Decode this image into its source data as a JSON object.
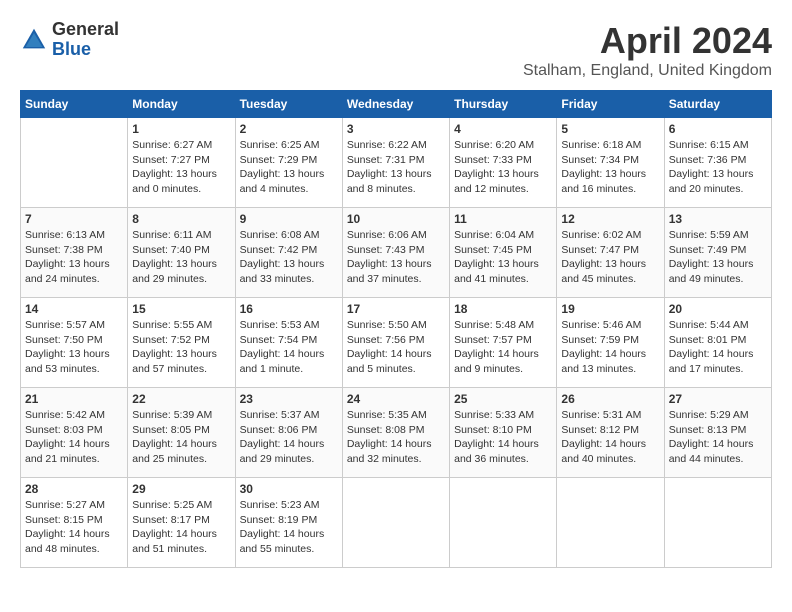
{
  "logo": {
    "general": "General",
    "blue": "Blue"
  },
  "title": "April 2024",
  "location": "Stalham, England, United Kingdom",
  "days_of_week": [
    "Sunday",
    "Monday",
    "Tuesday",
    "Wednesday",
    "Thursday",
    "Friday",
    "Saturday"
  ],
  "weeks": [
    [
      {
        "day": "",
        "content": ""
      },
      {
        "day": "1",
        "content": "Sunrise: 6:27 AM\nSunset: 7:27 PM\nDaylight: 13 hours\nand 0 minutes."
      },
      {
        "day": "2",
        "content": "Sunrise: 6:25 AM\nSunset: 7:29 PM\nDaylight: 13 hours\nand 4 minutes."
      },
      {
        "day": "3",
        "content": "Sunrise: 6:22 AM\nSunset: 7:31 PM\nDaylight: 13 hours\nand 8 minutes."
      },
      {
        "day": "4",
        "content": "Sunrise: 6:20 AM\nSunset: 7:33 PM\nDaylight: 13 hours\nand 12 minutes."
      },
      {
        "day": "5",
        "content": "Sunrise: 6:18 AM\nSunset: 7:34 PM\nDaylight: 13 hours\nand 16 minutes."
      },
      {
        "day": "6",
        "content": "Sunrise: 6:15 AM\nSunset: 7:36 PM\nDaylight: 13 hours\nand 20 minutes."
      }
    ],
    [
      {
        "day": "7",
        "content": "Sunrise: 6:13 AM\nSunset: 7:38 PM\nDaylight: 13 hours\nand 24 minutes."
      },
      {
        "day": "8",
        "content": "Sunrise: 6:11 AM\nSunset: 7:40 PM\nDaylight: 13 hours\nand 29 minutes."
      },
      {
        "day": "9",
        "content": "Sunrise: 6:08 AM\nSunset: 7:42 PM\nDaylight: 13 hours\nand 33 minutes."
      },
      {
        "day": "10",
        "content": "Sunrise: 6:06 AM\nSunset: 7:43 PM\nDaylight: 13 hours\nand 37 minutes."
      },
      {
        "day": "11",
        "content": "Sunrise: 6:04 AM\nSunset: 7:45 PM\nDaylight: 13 hours\nand 41 minutes."
      },
      {
        "day": "12",
        "content": "Sunrise: 6:02 AM\nSunset: 7:47 PM\nDaylight: 13 hours\nand 45 minutes."
      },
      {
        "day": "13",
        "content": "Sunrise: 5:59 AM\nSunset: 7:49 PM\nDaylight: 13 hours\nand 49 minutes."
      }
    ],
    [
      {
        "day": "14",
        "content": "Sunrise: 5:57 AM\nSunset: 7:50 PM\nDaylight: 13 hours\nand 53 minutes."
      },
      {
        "day": "15",
        "content": "Sunrise: 5:55 AM\nSunset: 7:52 PM\nDaylight: 13 hours\nand 57 minutes."
      },
      {
        "day": "16",
        "content": "Sunrise: 5:53 AM\nSunset: 7:54 PM\nDaylight: 14 hours\nand 1 minute."
      },
      {
        "day": "17",
        "content": "Sunrise: 5:50 AM\nSunset: 7:56 PM\nDaylight: 14 hours\nand 5 minutes."
      },
      {
        "day": "18",
        "content": "Sunrise: 5:48 AM\nSunset: 7:57 PM\nDaylight: 14 hours\nand 9 minutes."
      },
      {
        "day": "19",
        "content": "Sunrise: 5:46 AM\nSunset: 7:59 PM\nDaylight: 14 hours\nand 13 minutes."
      },
      {
        "day": "20",
        "content": "Sunrise: 5:44 AM\nSunset: 8:01 PM\nDaylight: 14 hours\nand 17 minutes."
      }
    ],
    [
      {
        "day": "21",
        "content": "Sunrise: 5:42 AM\nSunset: 8:03 PM\nDaylight: 14 hours\nand 21 minutes."
      },
      {
        "day": "22",
        "content": "Sunrise: 5:39 AM\nSunset: 8:05 PM\nDaylight: 14 hours\nand 25 minutes."
      },
      {
        "day": "23",
        "content": "Sunrise: 5:37 AM\nSunset: 8:06 PM\nDaylight: 14 hours\nand 29 minutes."
      },
      {
        "day": "24",
        "content": "Sunrise: 5:35 AM\nSunset: 8:08 PM\nDaylight: 14 hours\nand 32 minutes."
      },
      {
        "day": "25",
        "content": "Sunrise: 5:33 AM\nSunset: 8:10 PM\nDaylight: 14 hours\nand 36 minutes."
      },
      {
        "day": "26",
        "content": "Sunrise: 5:31 AM\nSunset: 8:12 PM\nDaylight: 14 hours\nand 40 minutes."
      },
      {
        "day": "27",
        "content": "Sunrise: 5:29 AM\nSunset: 8:13 PM\nDaylight: 14 hours\nand 44 minutes."
      }
    ],
    [
      {
        "day": "28",
        "content": "Sunrise: 5:27 AM\nSunset: 8:15 PM\nDaylight: 14 hours\nand 48 minutes."
      },
      {
        "day": "29",
        "content": "Sunrise: 5:25 AM\nSunset: 8:17 PM\nDaylight: 14 hours\nand 51 minutes."
      },
      {
        "day": "30",
        "content": "Sunrise: 5:23 AM\nSunset: 8:19 PM\nDaylight: 14 hours\nand 55 minutes."
      },
      {
        "day": "",
        "content": ""
      },
      {
        "day": "",
        "content": ""
      },
      {
        "day": "",
        "content": ""
      },
      {
        "day": "",
        "content": ""
      }
    ]
  ]
}
